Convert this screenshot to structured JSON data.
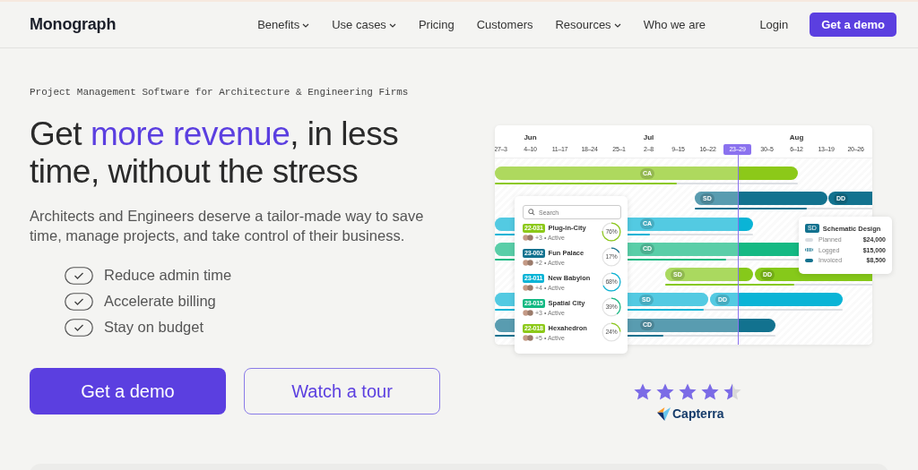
{
  "nav": {
    "logo": "Monograph",
    "links": [
      {
        "label": "Benefits",
        "dropdown": true
      },
      {
        "label": "Use cases",
        "dropdown": true
      },
      {
        "label": "Pricing",
        "dropdown": false
      },
      {
        "label": "Customers",
        "dropdown": false
      },
      {
        "label": "Resources",
        "dropdown": true
      },
      {
        "label": "Who we are",
        "dropdown": false
      }
    ],
    "login": "Login",
    "cta": "Get a demo"
  },
  "hero": {
    "eyebrow": "Project Management Software for Architecture & Engineering Firms",
    "heading": {
      "before": "Get ",
      "highlight": "more revenue",
      "after": ", in less time, without the stress"
    },
    "description": "Architects and Engineers deserve a tailor-made way to save time, manage projects, and take control of their business.",
    "benefits": [
      "Reduce admin time",
      "Accelerate billing",
      "Stay on budget"
    ],
    "primary_button": "Get a demo",
    "secondary_button": "Watch a tour"
  },
  "timeline": {
    "weeks": [
      {
        "label": "27–3",
        "selected": false
      },
      {
        "label": "4–10",
        "month": "Jun",
        "selected": false
      },
      {
        "label": "11–17",
        "selected": false
      },
      {
        "label": "18–24",
        "selected": false
      },
      {
        "label": "25–1",
        "selected": false
      },
      {
        "label": "2–8",
        "month": "Jul",
        "selected": false
      },
      {
        "label": "9–15",
        "selected": false
      },
      {
        "label": "16–22",
        "selected": false
      },
      {
        "label": "23–29",
        "selected": true
      },
      {
        "label": "30–5",
        "selected": false
      },
      {
        "label": "6–12",
        "month": "Aug",
        "selected": false
      },
      {
        "label": "13–19",
        "selected": false
      },
      {
        "label": "20–26",
        "selected": false
      }
    ],
    "rows": [
      {
        "color": "#8cc919",
        "phases": [
          "CA"
        ]
      },
      {
        "color": "#12728f",
        "phases": [
          "SD",
          "DD"
        ]
      },
      {
        "color": "#0ab4d6",
        "phases": [
          "CA"
        ]
      },
      {
        "color": "#14b983",
        "phases": [
          "CD"
        ]
      },
      {
        "color": "#86c91a",
        "phases": [
          "SD",
          "DD"
        ]
      },
      {
        "color": "#0ab4d6",
        "phases": [
          "SD",
          "DD"
        ]
      },
      {
        "color": "#12728f",
        "phases": [
          "CD"
        ]
      }
    ]
  },
  "projects": {
    "search_placeholder": "Search",
    "items": [
      {
        "code": "22-031",
        "color": "#8cc919",
        "name": "Plug-in-City",
        "meta": "+3 • Active",
        "percent": "76%"
      },
      {
        "code": "23-002",
        "color": "#12728f",
        "name": "Fun Palace",
        "meta": "+2 • Active",
        "percent": "17%"
      },
      {
        "code": "23-011",
        "color": "#0ab4d6",
        "name": "New Babylon",
        "meta": "+4 • Active",
        "percent": "68%"
      },
      {
        "code": "23-015",
        "color": "#14b983",
        "name": "Spatial City",
        "meta": "+3 • Active",
        "percent": "39%"
      },
      {
        "code": "22-018",
        "color": "#8cc919",
        "name": "Hexahedron",
        "meta": "+5 • Active",
        "percent": "24%"
      }
    ]
  },
  "phase_card": {
    "tag": "SD",
    "title": "Schematic Design",
    "lines": [
      {
        "kind": "planned",
        "label": "Planned",
        "amount": "$24,000"
      },
      {
        "kind": "logged",
        "label": "Logged",
        "amount": "$15,000"
      },
      {
        "kind": "invoiced",
        "label": "Invoiced",
        "amount": "$8,500"
      }
    ]
  },
  "rating": {
    "stars": 4.5,
    "source": "Capterra"
  }
}
